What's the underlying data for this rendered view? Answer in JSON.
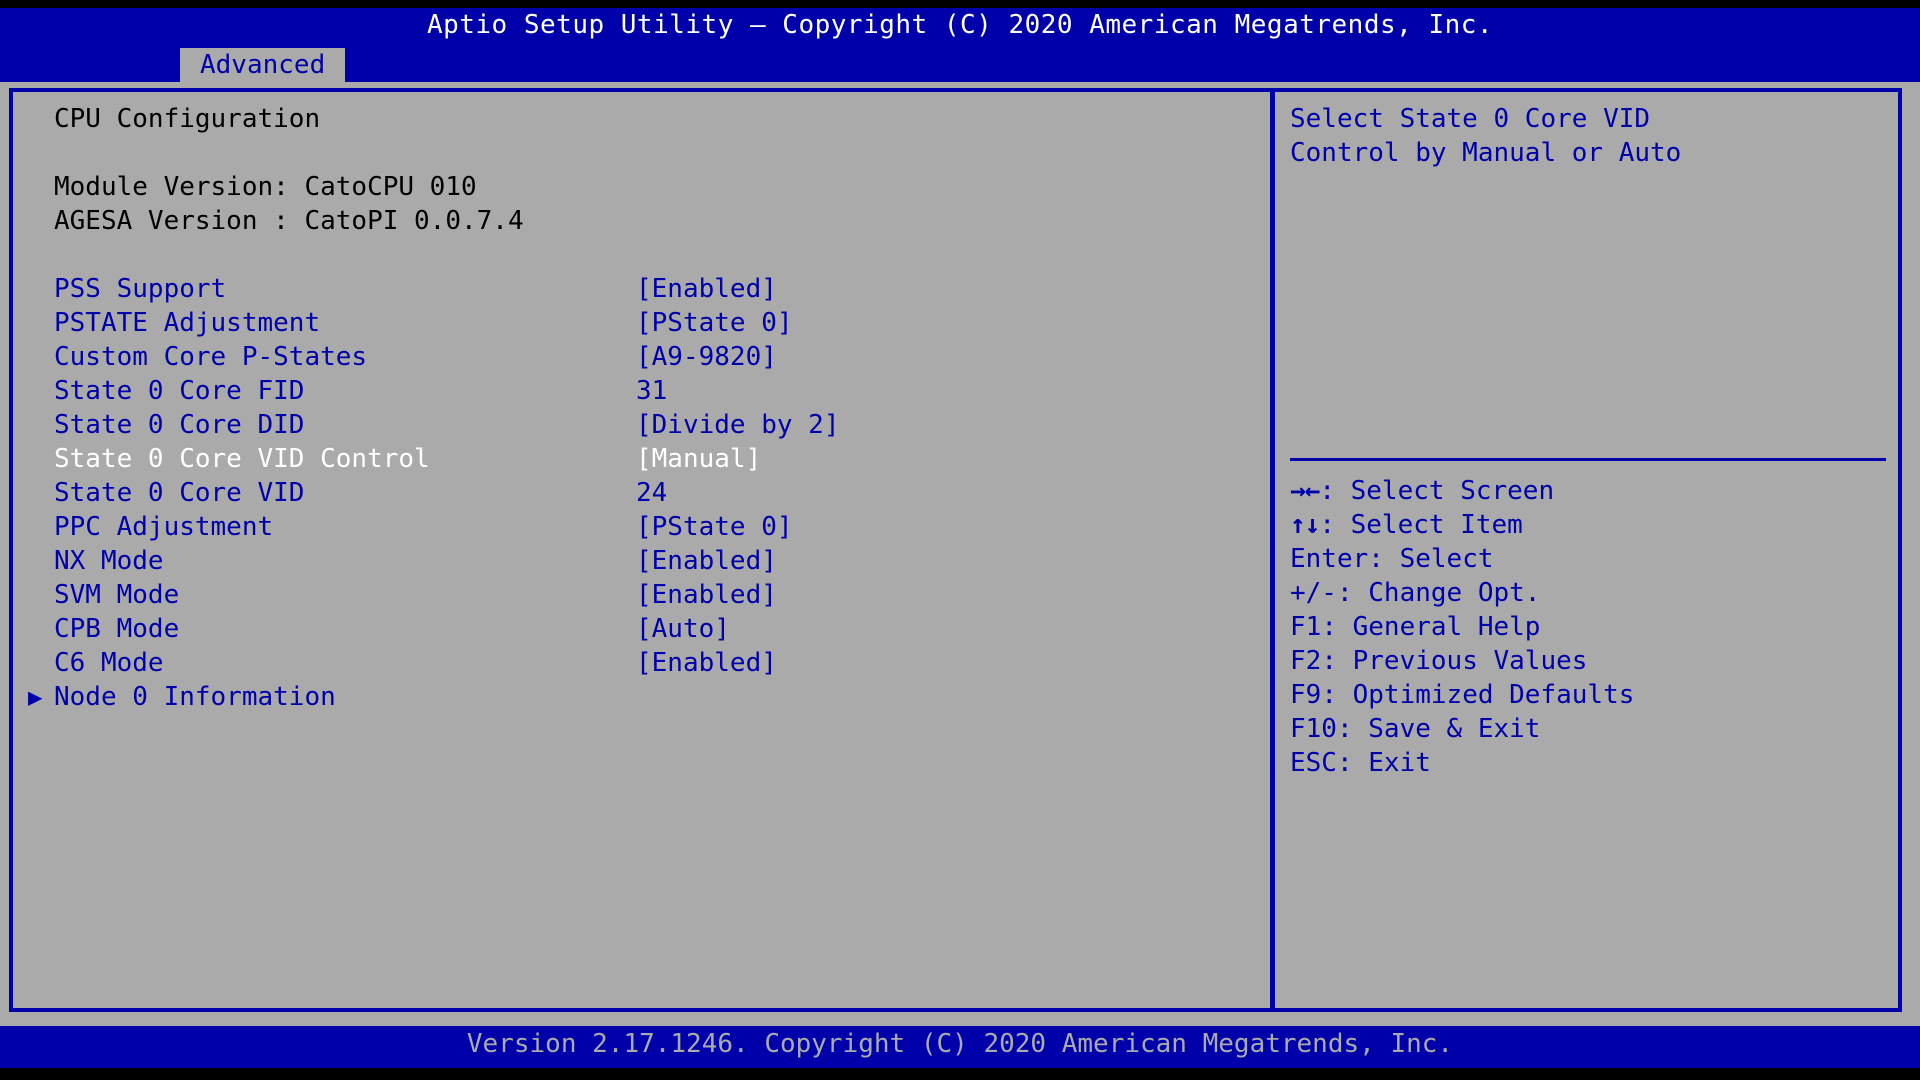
{
  "colors": {
    "title_bar_bg": "#0000aa",
    "panel_bg": "#aaaaaa",
    "label_blue": "#0000aa",
    "selected_white": "#ffffff",
    "header_black": "#000000",
    "screen_black": "#000000"
  },
  "header": {
    "title": "Aptio Setup Utility – Copyright (C) 2020 American Megatrends, Inc.",
    "active_tab": "Advanced"
  },
  "main": {
    "section_title": "CPU Configuration",
    "info_lines": [
      "Module Version: CatoCPU 010",
      "AGESA Version : CatoPI 0.0.7.4"
    ],
    "options": [
      {
        "label": "PSS Support",
        "value": "[Enabled]",
        "selected": false,
        "submenu": false
      },
      {
        "label": "PSTATE Adjustment",
        "value": "[PState 0]",
        "selected": false,
        "submenu": false
      },
      {
        "label": "Custom Core P-States",
        "value": "[A9-9820]",
        "selected": false,
        "submenu": false
      },
      {
        "label": "State 0 Core FID",
        "value": "31",
        "selected": false,
        "submenu": false
      },
      {
        "label": "State 0 Core DID",
        "value": "[Divide by 2]",
        "selected": false,
        "submenu": false
      },
      {
        "label": "State 0 Core VID Control",
        "value": "[Manual]",
        "selected": true,
        "submenu": false
      },
      {
        "label": "State 0 Core VID",
        "value": "24",
        "selected": false,
        "submenu": false
      },
      {
        "label": "PPC Adjustment",
        "value": "[PState 0]",
        "selected": false,
        "submenu": false
      },
      {
        "label": "NX Mode",
        "value": "[Enabled]",
        "selected": false,
        "submenu": false
      },
      {
        "label": "SVM Mode",
        "value": "[Enabled]",
        "selected": false,
        "submenu": false
      },
      {
        "label": "CPB Mode",
        "value": "[Auto]",
        "selected": false,
        "submenu": false
      },
      {
        "label": "C6 Mode",
        "value": "[Enabled]",
        "selected": false,
        "submenu": false
      },
      {
        "label": "Node 0 Information",
        "value": "",
        "selected": false,
        "submenu": true,
        "arrow": "▶"
      }
    ]
  },
  "help": {
    "lines": [
      "Select State 0 Core VID",
      "Control by Manual or Auto"
    ]
  },
  "legend": {
    "items": [
      {
        "keys": "→←",
        "text": ": Select Screen",
        "glyph": true
      },
      {
        "keys": "↑↓",
        "text": ": Select Item",
        "glyph": true
      },
      {
        "keys": "Enter",
        "text": ": Select",
        "glyph": false
      },
      {
        "keys": "+/-",
        "text": ": Change Opt.",
        "glyph": false
      },
      {
        "keys": "F1",
        "text": ": General Help",
        "glyph": false
      },
      {
        "keys": "F2",
        "text": ": Previous Values",
        "glyph": false
      },
      {
        "keys": "F9",
        "text": ": Optimized Defaults",
        "glyph": false
      },
      {
        "keys": "F10",
        "text": ": Save & Exit",
        "glyph": false
      },
      {
        "keys": "ESC",
        "text": ": Exit",
        "glyph": false
      }
    ]
  },
  "footer": {
    "text": "Version 2.17.1246. Copyright (C) 2020 American Megatrends, Inc."
  }
}
